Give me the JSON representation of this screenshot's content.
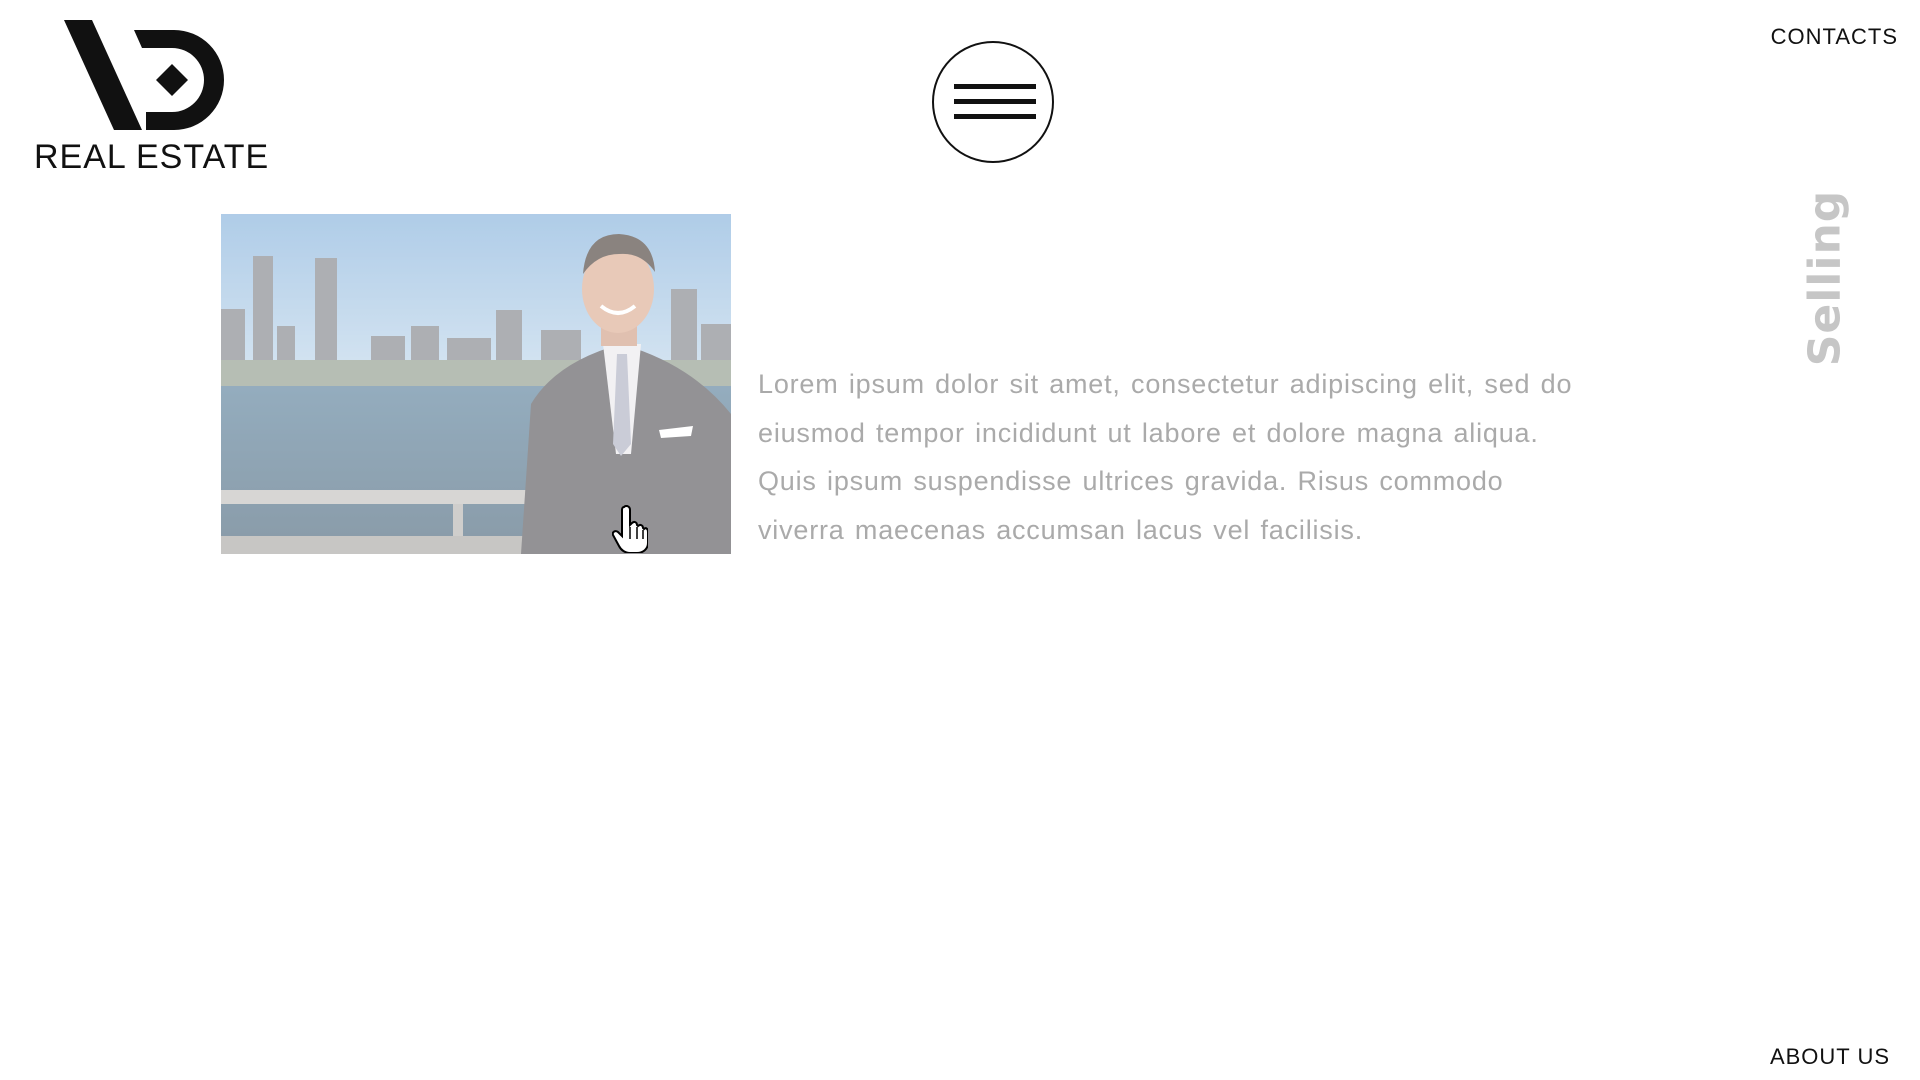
{
  "logo": {
    "text": "REAL ESTATE"
  },
  "nav": {
    "contacts_label": "CONTACTS",
    "about_label": "ABOUT US",
    "menu_icon": "hamburger-icon"
  },
  "section": {
    "vertical_heading": "Selling",
    "body_lines": [
      "Lorem ipsum dolor sit amet, consectetur adipiscing elit, sed do",
      "eiusmod tempor incididunt ut labore et dolore magna aliqua.",
      "Quis ipsum suspendisse ultrices gravida. Risus commodo",
      "viverra maecenas accumsan lacus vel facilisis."
    ]
  },
  "colors": {
    "text_dark": "#111111",
    "text_muted": "#aaaaaa",
    "heading_muted": "#c6c6c6",
    "background": "#ffffff"
  },
  "icons": {
    "cursor": "hand-pointer-icon"
  }
}
